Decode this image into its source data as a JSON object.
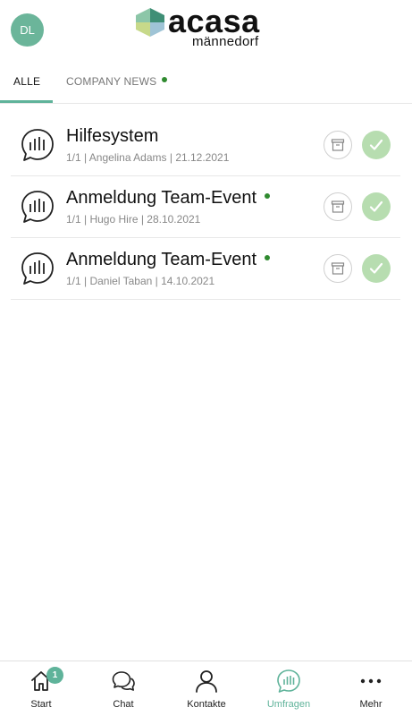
{
  "header": {
    "avatar_initials": "DL",
    "brand_name": "acasa",
    "brand_subtitle": "männedorf"
  },
  "tabs": [
    {
      "label": "ALLE",
      "active": true,
      "has_new": false
    },
    {
      "label": "COMPANY NEWS",
      "active": false,
      "has_new": true
    }
  ],
  "items": [
    {
      "title": "Hilfesystem",
      "meta": "1/1 | Angelina Adams | 21.12.2021",
      "has_new": false
    },
    {
      "title": "Anmeldung Team-Event",
      "meta": "1/1 | Hugo Hire | 28.10.2021",
      "has_new": true
    },
    {
      "title": "Anmeldung Team-Event",
      "meta": "1/1 | Daniel Taban | 14.10.2021",
      "has_new": true
    }
  ],
  "bottom_nav": [
    {
      "label": "Start",
      "icon": "home-icon",
      "badge": "1",
      "active": false
    },
    {
      "label": "Chat",
      "icon": "chat-icon",
      "active": false
    },
    {
      "label": "Kontakte",
      "icon": "person-icon",
      "active": false
    },
    {
      "label": "Umfragen",
      "icon": "poll-icon",
      "active": true
    },
    {
      "label": "Mehr",
      "icon": "more-icon",
      "active": false
    }
  ],
  "colors": {
    "accent": "#5fb39a",
    "new_dot": "#2f8a2f",
    "check_bg": "#b7ddb0"
  }
}
